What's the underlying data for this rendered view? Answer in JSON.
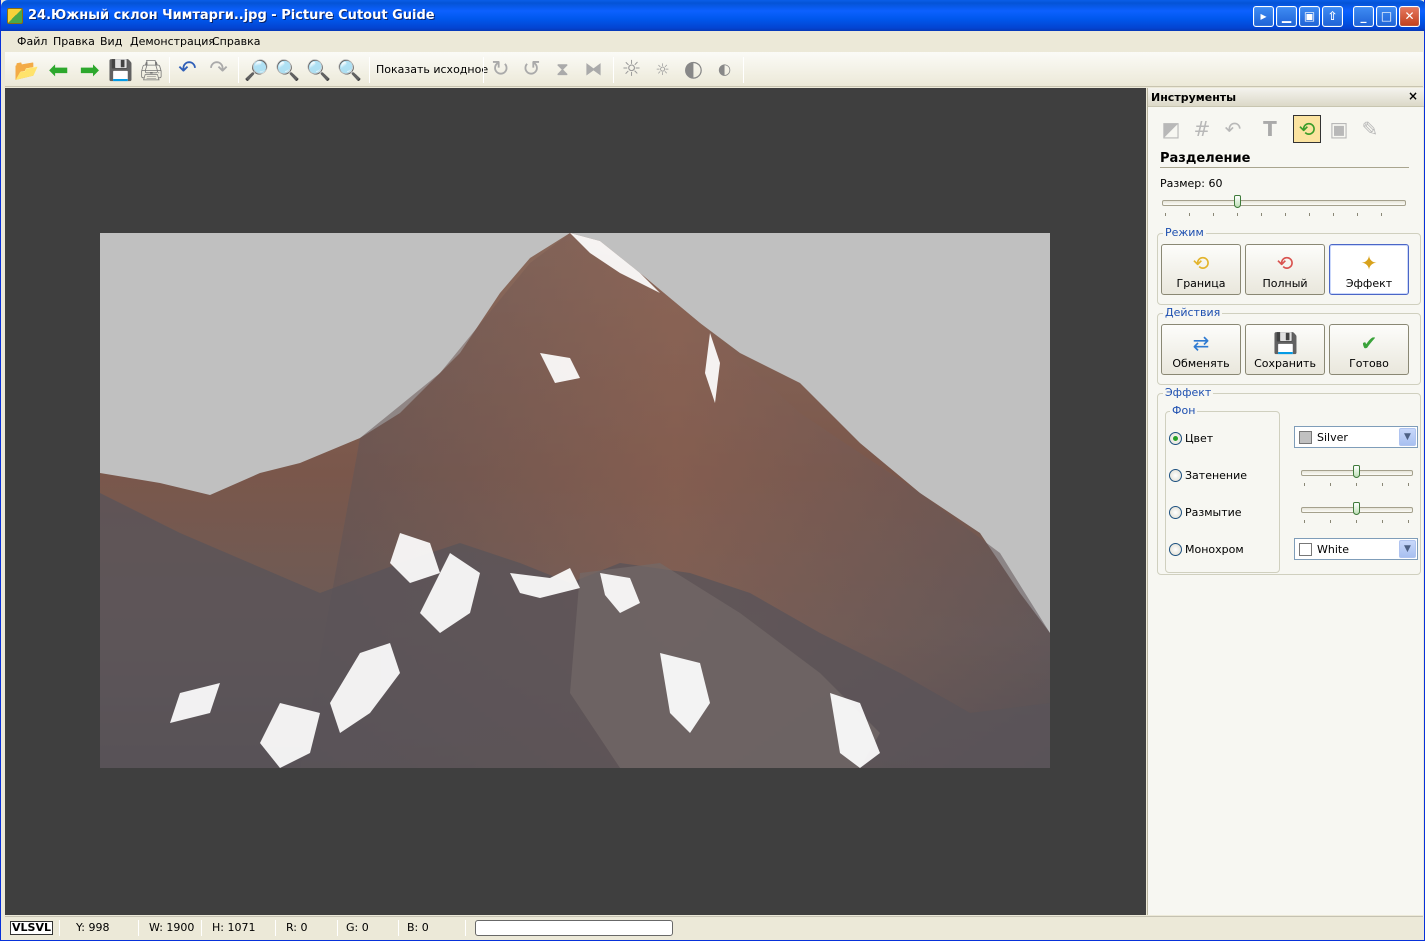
{
  "window": {
    "title": "24.Южный склон Чимтарги..jpg - Picture Cutout Guide",
    "controls": [
      "▸",
      "▁",
      "▣",
      "⇧"
    ]
  },
  "menu": [
    "Файл",
    "Правка",
    "Вид",
    "Демонстрация",
    "Справка"
  ],
  "toolbar": {
    "show_original_label": "Показать исходное",
    "icons": [
      "open-folder-icon",
      "back-arrow-icon",
      "forward-arrow-icon",
      "save-icon",
      "print-icon",
      "undo-icon",
      "redo-icon",
      "zoom-in-icon",
      "zoom-out-icon",
      "zoom-fit-icon",
      "zoom-actual-icon",
      "rotate-right-icon",
      "rotate-left-icon",
      "flip-vertical-icon",
      "flip-horizontal-icon",
      "brightness-up-icon",
      "brightness-down-icon",
      "contrast-up-icon",
      "contrast-down-icon"
    ]
  },
  "panel": {
    "title": "Инструменты",
    "close": "×",
    "section_title": "Разделение",
    "size_label": "Размер: 60",
    "size_value": 60,
    "mode": {
      "legend": "Режим",
      "buttons": [
        {
          "label": "Граница",
          "icon": "border-mode-icon"
        },
        {
          "label": "Полный",
          "icon": "full-mode-icon"
        },
        {
          "label": "Эффект",
          "icon": "effect-mode-icon",
          "selected": true
        }
      ]
    },
    "actions": {
      "legend": "Действия",
      "buttons": [
        {
          "label": "Обменять",
          "icon": "swap-icon"
        },
        {
          "label": "Сохранить",
          "icon": "save-icon"
        },
        {
          "label": "Готово",
          "icon": "checkmark-icon"
        }
      ]
    },
    "effect": {
      "legend": "Эффект",
      "background_legend": "Фон",
      "options": [
        "Цвет",
        "Затенение",
        "Размытие",
        "Монохром"
      ],
      "selected": "Цвет",
      "color_value": "Silver",
      "color_hex": "#c0c0c0",
      "mono_value": "White",
      "mono_hex": "#ffffff"
    }
  },
  "status": {
    "logo": "VLSVL",
    "y": "Y: 998",
    "w": "W: 1900",
    "h": "H: 1071",
    "r": "R: 0",
    "g": "G: 0",
    "b": "B: 0"
  }
}
